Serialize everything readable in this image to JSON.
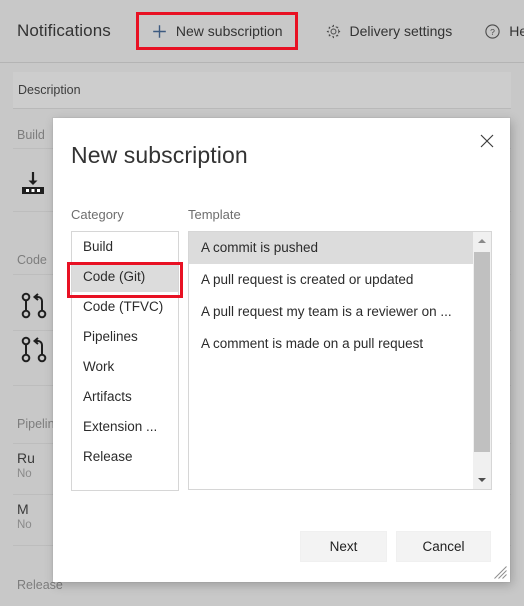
{
  "toolbar": {
    "title": "Notifications",
    "new_subscription": "New subscription",
    "delivery_settings": "Delivery settings",
    "help": "Help",
    "plus_icon": "plus-icon",
    "gear_icon": "gear-icon",
    "help_icon": "question-circle-icon",
    "highlight_color": "#e81123"
  },
  "background": {
    "description_header": "Description",
    "sections": [
      {
        "label": "Build"
      },
      {
        "label": "Code"
      },
      {
        "label": "Pipelines"
      },
      {
        "label": "Release"
      }
    ],
    "rows": [
      {
        "title": "Ru",
        "sub": "No"
      },
      {
        "title": "M",
        "sub": "No"
      }
    ]
  },
  "dialog": {
    "title": "New subscription",
    "close_icon": "close-icon",
    "category_label": "Category",
    "template_label": "Template",
    "categories": [
      "Build",
      "Code (Git)",
      "Code (TFVC)",
      "Pipelines",
      "Work",
      "Artifacts",
      "Extension ...",
      "Release"
    ],
    "selected_category": "Code (Git)",
    "templates": [
      "A commit is pushed",
      "A pull request is created or updated",
      "A pull request my team is a reviewer on ...",
      "A comment is made on a pull request"
    ],
    "selected_template": "A commit is pushed",
    "next_label": "Next",
    "cancel_label": "Cancel",
    "scrollbar": {
      "up_icon": "chevron-up-icon",
      "down_icon": "chevron-down-icon"
    },
    "resize_grip_icon": "resize-grip-icon"
  }
}
